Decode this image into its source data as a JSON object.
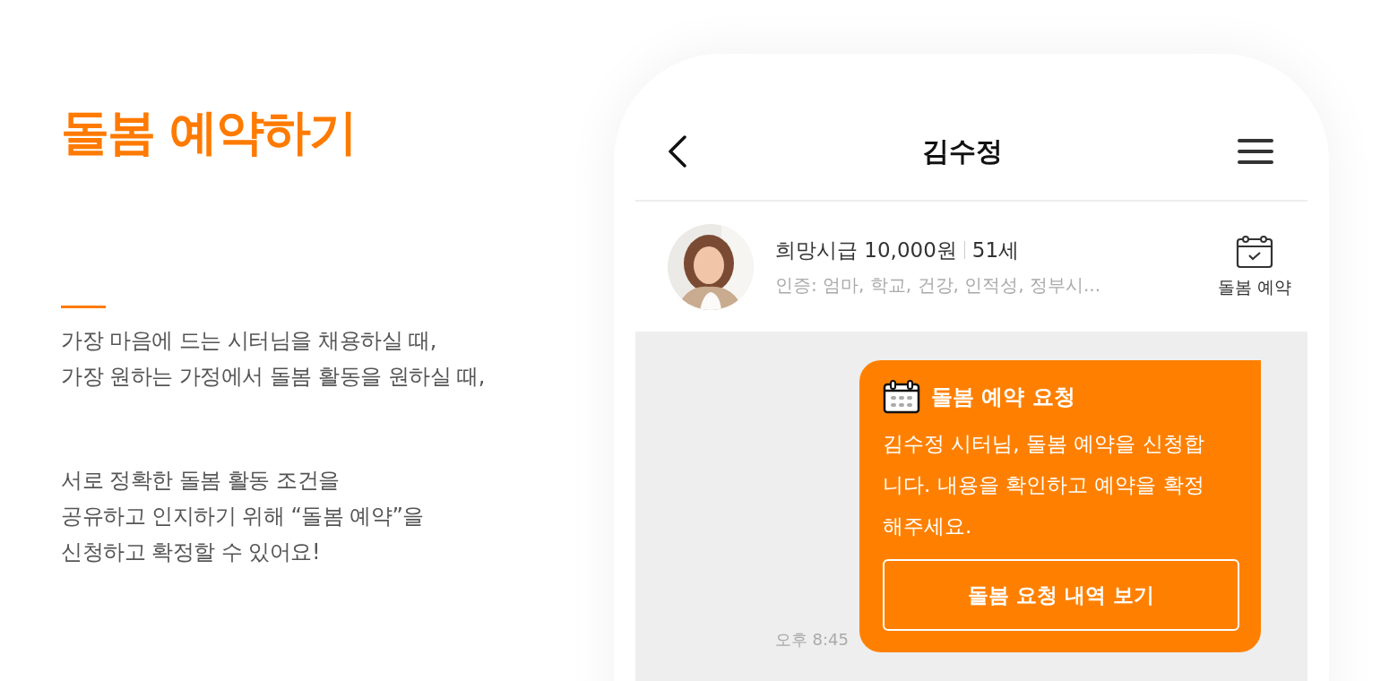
{
  "intro": {
    "heading": "돌봄 예약하기",
    "paragraphs": [
      {
        "lines": [
          "가장 마음에 드는 시터님을 채용하실 때,",
          "가장 원하는 가정에서 돌봄 활동을 원하실 때,"
        ]
      },
      {
        "lines": [
          "서로 정확한 돌봄 활동 조건을",
          "공유하고 인지하기 위해 “돌봄 예약”을",
          "신청하고 확정할 수 있어요!"
        ]
      }
    ]
  },
  "phone": {
    "header": {
      "title": "김수정"
    },
    "profile": {
      "wage": "희망시급 10,000원",
      "age": "51세",
      "certifications": "인증: 엄마, 학교, 건강, 인적성, 정부시...",
      "action": "돌봄 예약"
    },
    "messages": [
      {
        "kind": "booking",
        "title": "돌봄 예약 요청",
        "body": "김수정 시터님, 돌봄 예약을 신청합니다. 내용을 확인하고 예약을 확정해주세요.",
        "button": "돌봄 요청 내역 보기",
        "time": "오후 8:45"
      }
    ]
  }
}
